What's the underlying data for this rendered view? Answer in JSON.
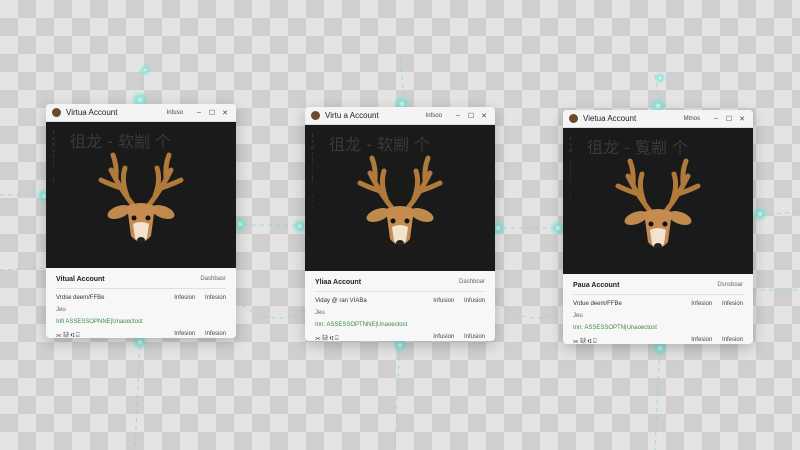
{
  "windows": [
    {
      "title": "Virtua Account",
      "titlebar_label": "Infuso",
      "cjk_heading": "徂龙 - 软剬 个",
      "account_label": "Vitual Account",
      "account_sub": "Dashbasr",
      "user_line": "Vrdse deem/FFBe",
      "action_1": "Infesion",
      "action_2": "Infesion",
      "meta_line": "Jeu",
      "green_line": "Infi ASSESSOPNNE|Unaoectost",
      "footer_text": "⫘ 缺 ⑆ ⍇",
      "code_chars": "t\nc\nd\ns\n|\n|\n:\n·\n|\n·\n·\n·\n:\n·\n·\n·"
    },
    {
      "title": "Virtu a Account",
      "titlebar_label": "Infsoo",
      "cjk_heading": "徂龙 - 软剬 个",
      "account_label": "Yliaa Account",
      "account_sub": "Dashboar",
      "user_line": "Viday @ ran VIABa",
      "action_1": "Infusion",
      "action_2": "Infusion",
      "meta_line": "Jeu",
      "green_line": "Inn: ASSESSOPTNNE|Unaoectost",
      "footer_text": "⫘ 缺 ⑆ ⍇",
      "code_chars": "t\ns\nd\n:\n|\n·\n:\n|\n·\n·\n:\n·\n·\n·\n·\n·"
    },
    {
      "title": "Vietua Account",
      "titlebar_label": "Mtnos",
      "cjk_heading": "徂龙 - 覧剬 个",
      "account_label": "Paua Account",
      "account_sub": "Dsnsboar",
      "user_line": "Vrdue deem/FFBe",
      "action_1": "Infesion",
      "action_2": "Infesion",
      "meta_line": "Jeu",
      "green_line": "Inn: ASSESSOPTN|Unaoectost",
      "footer_text": "⫘ 缺 ⑆ ⍇",
      "code_chars": "t\ns\nd\n:\n|\n:\n|\n:\n·\n·\n:\n·\n·\n·\n·\n·"
    }
  ],
  "colors": {
    "accent_glow": "#7fe3d6",
    "panel_dark": "#1a1a1a",
    "antler": "#b07a3a"
  }
}
